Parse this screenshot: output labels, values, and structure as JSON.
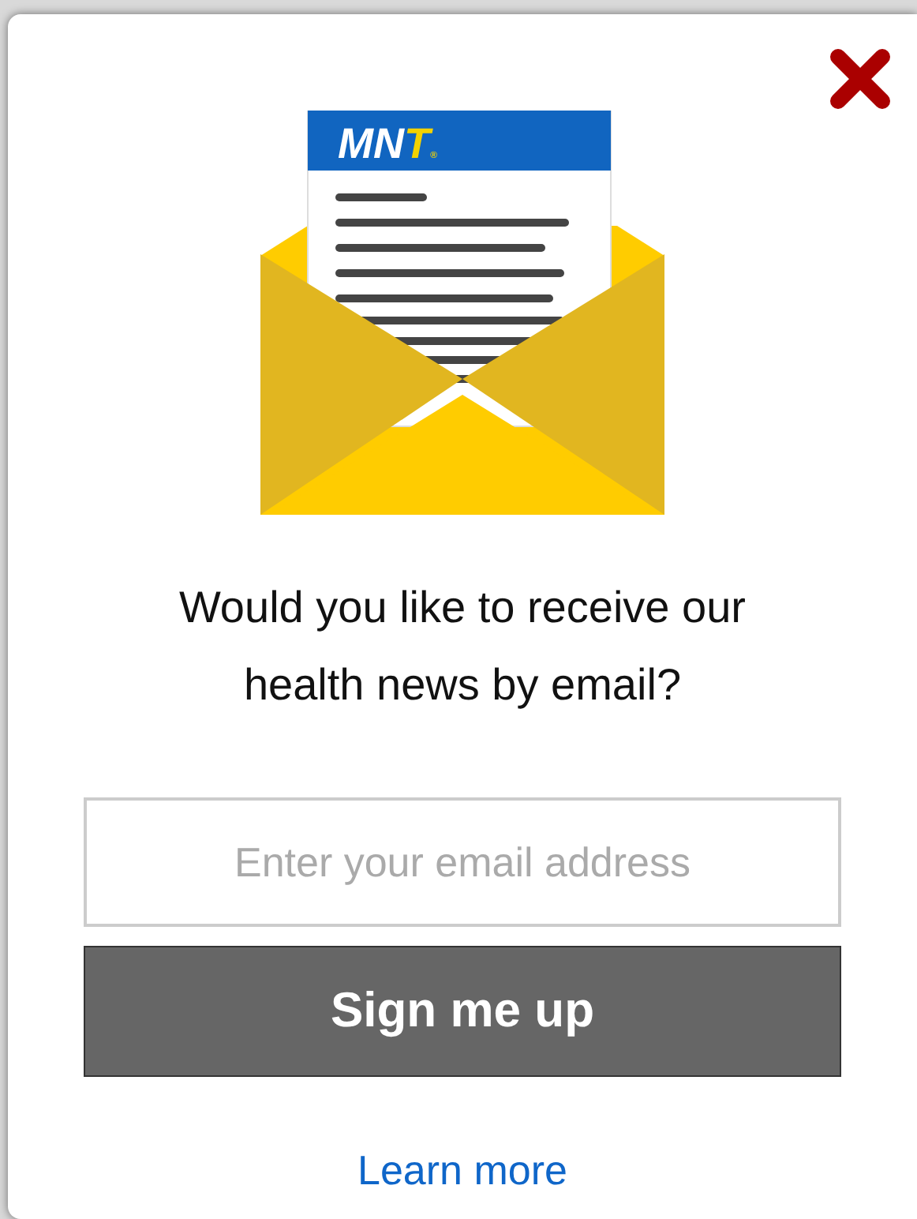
{
  "logo": {
    "text": "MNT",
    "mark": "®"
  },
  "heading": "Would you like to receive our health news by email?",
  "email": {
    "placeholder": "Enter your email address"
  },
  "submit": "Sign me up",
  "link": "Learn more"
}
